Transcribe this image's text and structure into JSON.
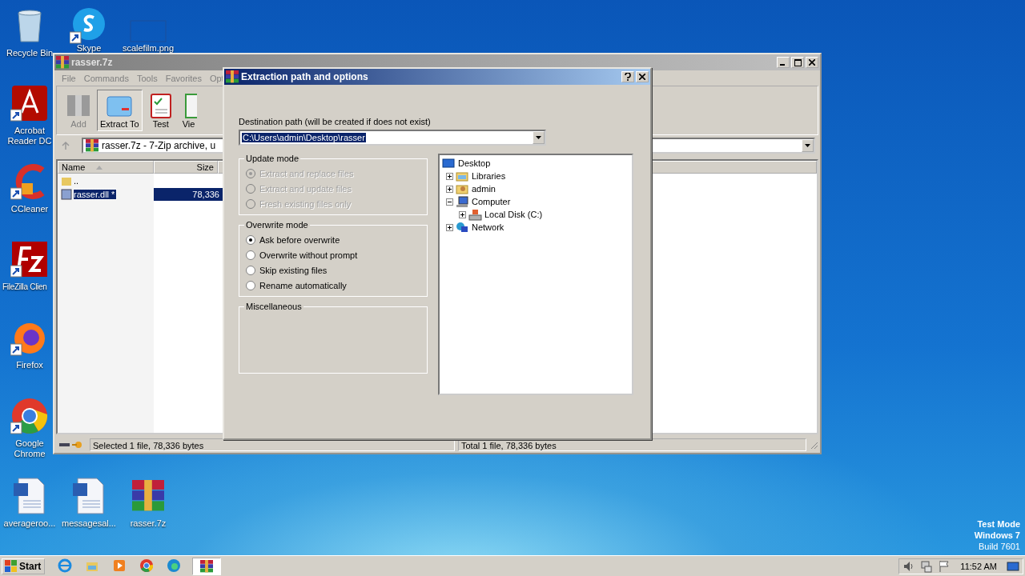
{
  "desktop_icons": [
    {
      "label": "Recycle Bin",
      "kind": "recycle",
      "shortcut": false
    },
    {
      "label": "Skype",
      "kind": "skype",
      "shortcut": true
    },
    {
      "label": "scalefilm.png",
      "kind": "blank",
      "shortcut": false
    },
    {
      "label": "Acrobat Reader DC",
      "kind": "acrobat",
      "shortcut": true
    },
    {
      "label": "CCleaner",
      "kind": "ccleaner",
      "shortcut": true
    },
    {
      "label": "FileZilla Clien",
      "kind": "filezilla",
      "shortcut": true
    },
    {
      "label": "Firefox",
      "kind": "firefox",
      "shortcut": true
    },
    {
      "label": "Google Chrome",
      "kind": "chrome",
      "shortcut": true
    },
    {
      "label": "averageroo...",
      "kind": "word",
      "shortcut": false
    },
    {
      "label": "messagesal...",
      "kind": "word",
      "shortcut": false
    },
    {
      "label": "rasser.7z",
      "kind": "archive",
      "shortcut": false
    }
  ],
  "main_window": {
    "title": "rasser.7z",
    "menu": [
      "File",
      "Commands",
      "Tools",
      "Favorites",
      "Opt"
    ],
    "toolbar": [
      {
        "label": "Add",
        "kind": "add",
        "disabled": true,
        "pressed": false
      },
      {
        "label": "Extract To",
        "kind": "extract",
        "disabled": false,
        "pressed": true
      },
      {
        "label": "Test",
        "kind": "test",
        "disabled": false,
        "pressed": false
      },
      {
        "label": "Vie",
        "kind": "view",
        "disabled": false,
        "pressed": false
      }
    ],
    "address": "rasser.7z - 7-Zip archive, u",
    "columns": [
      {
        "label": "Name",
        "sorted": true
      },
      {
        "label": "Size",
        "sorted": false
      }
    ],
    "rows": [
      {
        "name": "..",
        "kind": "folder",
        "selected": false
      },
      {
        "name": "rasser.dll *",
        "kind": "file",
        "size": "78,336",
        "selected": true
      }
    ],
    "status": [
      "Selected 1 file, 78,336 bytes",
      "Total 1 file, 78,336 bytes"
    ]
  },
  "dialog": {
    "title": "Extraction path and options",
    "path_label": "Destination path (will be created if does not exist)",
    "path_value": "C:\\Users\\admin\\Desktop\\rasser",
    "groups": [
      {
        "title": "Update mode",
        "options": [
          {
            "label": "Extract and replace files",
            "selected": true,
            "disabled": true
          },
          {
            "label": "Extract and update files",
            "selected": false,
            "disabled": true
          },
          {
            "label": "Fresh existing files only",
            "selected": false,
            "disabled": true
          }
        ]
      },
      {
        "title": "Overwrite mode",
        "options": [
          {
            "label": "Ask before overwrite",
            "selected": true,
            "disabled": false
          },
          {
            "label": "Overwrite without prompt",
            "selected": false,
            "disabled": false
          },
          {
            "label": "Skip existing files",
            "selected": false,
            "disabled": false
          },
          {
            "label": "Rename automatically",
            "selected": false,
            "disabled": false
          }
        ]
      },
      {
        "title": "Miscellaneous"
      }
    ],
    "tree": {
      "label": "Desktop",
      "kind": "desktop",
      "children": [
        {
          "label": "Libraries",
          "kind": "libraries",
          "expanded": false
        },
        {
          "label": "admin",
          "kind": "user",
          "expanded": false
        },
        {
          "label": "Computer",
          "kind": "computer",
          "expanded": true,
          "children": [
            {
              "label": "Local Disk (C:)",
              "kind": "disk",
              "expanded": false
            }
          ]
        },
        {
          "label": "Network",
          "kind": "network",
          "expanded": false
        }
      ]
    }
  },
  "system_text": [
    "Test Mode",
    "Windows 7",
    "Build 7601"
  ],
  "taskbar": {
    "start": "Start",
    "apps": [
      {
        "kind": "ie",
        "active": false
      },
      {
        "kind": "explorer",
        "active": false
      },
      {
        "kind": "media",
        "active": false
      },
      {
        "kind": "chrome",
        "active": false
      },
      {
        "kind": "edge",
        "active": false
      },
      {
        "kind": "archive",
        "active": true
      }
    ],
    "clock": "11:52 AM"
  }
}
